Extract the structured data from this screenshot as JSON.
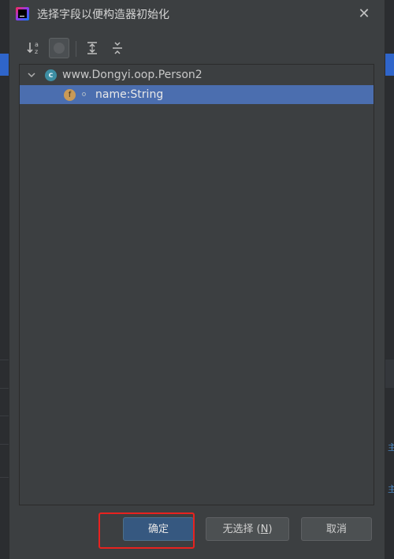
{
  "dialog": {
    "title": "选择字段以便构造器初始化",
    "close_glyph": "✕"
  },
  "toolbar": {
    "items": [
      {
        "name": "sort-alphabetically-icon",
        "state": "normal"
      },
      {
        "name": "show-inherited-icon",
        "state": "toggled"
      },
      {
        "name": "expand-all-icon",
        "state": "normal"
      },
      {
        "name": "collapse-all-icon",
        "state": "normal"
      }
    ]
  },
  "tree": {
    "class_node": {
      "label": "www.Dongyi.oop.Person2",
      "icon_letter": "c",
      "expanded": true
    },
    "fields": [
      {
        "label": "name:String",
        "icon_letter": "f",
        "selected": true
      }
    ]
  },
  "buttons": {
    "ok": "确定",
    "none_prefix": "无选择 (",
    "none_mnemonic": "N",
    "none_suffix": ")",
    "cancel": "取消"
  },
  "annotation": {
    "color": "#e8221f",
    "target": "ok"
  },
  "colors": {
    "selection": "#4b6eaf",
    "primary_button": "#365880",
    "dialog_bg": "#3c3f41",
    "class_icon": "#3d8ea3",
    "field_icon": "#c99a57"
  },
  "background_edge": {
    "right_marks": [
      "主",
      "主"
    ]
  }
}
